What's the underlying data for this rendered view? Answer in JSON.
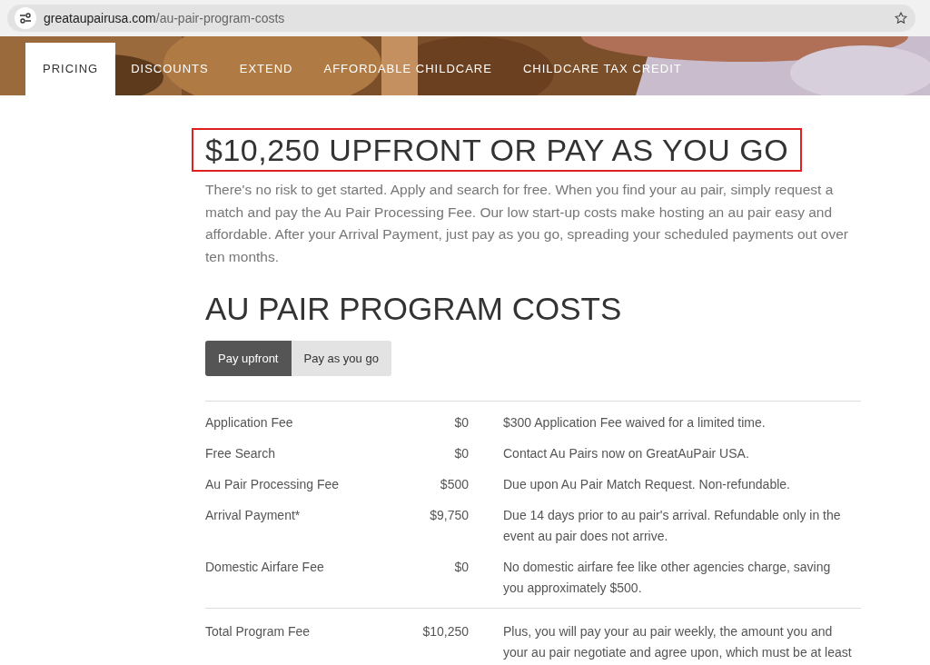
{
  "address_bar": {
    "host": "greataupairusa.com",
    "path": "/au-pair-program-costs"
  },
  "nav_tabs": [
    {
      "label": "PRICING",
      "selected": true
    },
    {
      "label": "DISCOUNTS",
      "selected": false
    },
    {
      "label": "EXTEND",
      "selected": false
    },
    {
      "label": "AFFORDABLE CHILDCARE",
      "selected": false
    },
    {
      "label": "CHILDCARE TAX CREDIT",
      "selected": false
    }
  ],
  "headline": {
    "text": "$10,250 UPFRONT OR PAY AS YOU GO",
    "highlighted": true
  },
  "intro": "There's no risk to get started. Apply and search for free. When you find your au pair, simply request a match and pay the Au Pair Processing Fee. Our low start-up costs make hosting an au pair easy and affordable. After your Arrival Payment, just pay as you go, spreading your scheduled payments out over ten months.",
  "section_title": "AU PAIR PROGRAM COSTS",
  "payment_toggle": [
    {
      "label": "Pay upfront",
      "selected": true
    },
    {
      "label": "Pay as you go",
      "selected": false
    }
  ],
  "cost_rows": [
    {
      "label": "Application Fee",
      "amount": "$0",
      "note": "$300 Application Fee waived for a limited time."
    },
    {
      "label": "Free Search",
      "amount": "$0",
      "note": "Contact Au Pairs now on GreatAuPair USA."
    },
    {
      "label": "Au Pair Processing Fee",
      "amount": "$500",
      "note": "Due upon Au Pair Match Request. Non-refundable."
    },
    {
      "label": "Arrival Payment*",
      "amount": "$9,750",
      "note": "Due 14 days prior to au pair's arrival. Refundable only in the event au pair does not arrive."
    },
    {
      "label": "Domestic Airfare Fee",
      "amount": "$0",
      "note": "No domestic airfare fee like other agencies charge, saving you approximately $500."
    }
  ],
  "total_row": {
    "label": "Total Program Fee",
    "amount": "$10,250",
    "note": "Plus, you will pay your au pair weekly, the amount you and your au pair negotiate and agree upon, which must be at least"
  }
}
